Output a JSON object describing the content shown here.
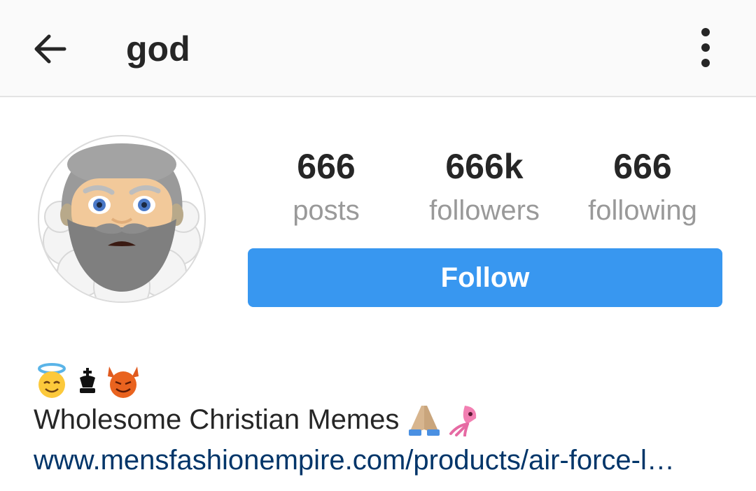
{
  "header": {
    "username": "god",
    "back_icon": "arrow-left-icon",
    "menu_icon": "more-vertical-icon"
  },
  "profile": {
    "avatar_icon": "old-man-emoji-avatar",
    "stats": [
      {
        "value": "666",
        "label": "posts"
      },
      {
        "value": "666k",
        "label": "followers"
      },
      {
        "value": "666",
        "label": "following"
      }
    ],
    "follow_label": "Follow"
  },
  "bio": {
    "emoji_line": [
      "smiling-face-with-halo-emoji",
      "chess-king-emoji",
      "smiling-face-with-horns-emoji"
    ],
    "text": "Wholesome Christian Memes",
    "text_emojis": [
      "folded-hands-emoji",
      "squid-emoji"
    ],
    "link": "www.mensfashionempire.com/products/air-force-l…"
  },
  "colors": {
    "accent": "#3897f0",
    "link": "#003569",
    "text": "#262626",
    "muted": "#999999",
    "topbar_bg": "#fafafa"
  }
}
